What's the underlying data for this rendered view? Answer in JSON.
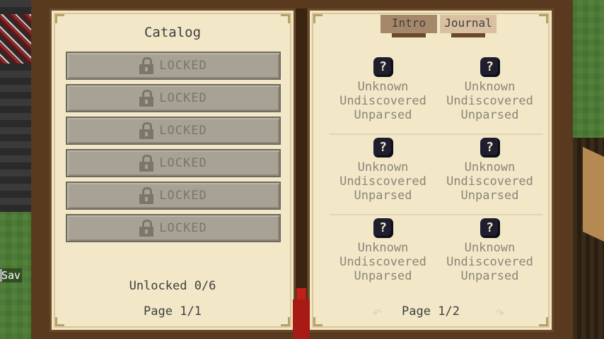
{
  "hud": {
    "text": "Sav"
  },
  "catalog": {
    "title": "Catalog",
    "items": [
      {
        "label": "LOCKED"
      },
      {
        "label": "LOCKED"
      },
      {
        "label": "LOCKED"
      },
      {
        "label": "LOCKED"
      },
      {
        "label": "LOCKED"
      },
      {
        "label": "LOCKED"
      }
    ],
    "unlocked": "Unlocked 0/6",
    "page": "Page 1/1"
  },
  "journal": {
    "tabs": [
      {
        "label": "Intro"
      },
      {
        "label": "Journal"
      }
    ],
    "entries": [
      {
        "icon": "?",
        "lines": [
          "Unknown",
          "Undiscovered",
          "Unparsed"
        ]
      },
      {
        "icon": "?",
        "lines": [
          "Unknown",
          "Undiscovered",
          "Unparsed"
        ]
      },
      {
        "icon": "?",
        "lines": [
          "Unknown",
          "Undiscovered",
          "Unparsed"
        ]
      },
      {
        "icon": "?",
        "lines": [
          "Unknown",
          "Undiscovered",
          "Unparsed"
        ]
      },
      {
        "icon": "?",
        "lines": [
          "Unknown",
          "Undiscovered",
          "Unparsed"
        ]
      },
      {
        "icon": "?",
        "lines": [
          "Unknown",
          "Undiscovered",
          "Unparsed"
        ]
      }
    ],
    "page": "Page 1/2",
    "prev_icon": "arrow-left-icon",
    "next_icon": "arrow-right-icon"
  }
}
